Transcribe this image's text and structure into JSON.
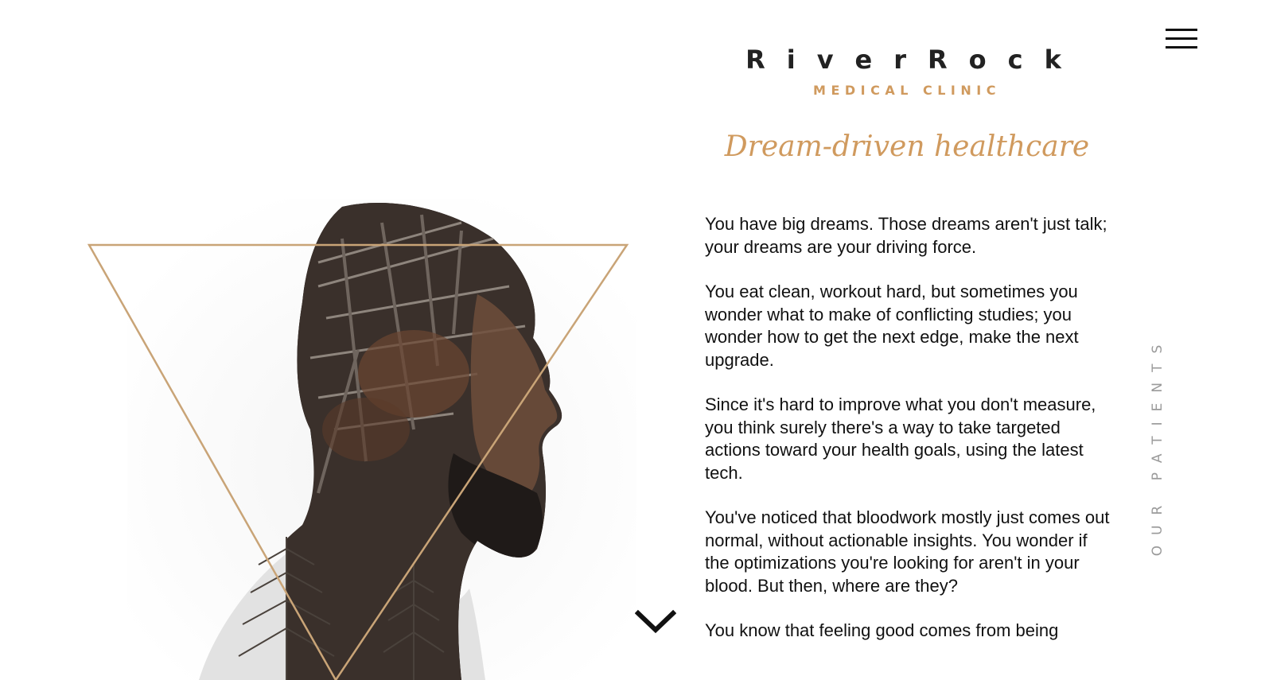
{
  "logo": {
    "name": "RiverRock",
    "subtitle": "MEDICAL CLINIC"
  },
  "header": {
    "tagline": "Dream-driven healthcare",
    "menu_icon": "hamburger-menu-icon"
  },
  "side_nav": {
    "label": "OUR PATIENTS"
  },
  "main": {
    "paragraphs": [
      "You have big dreams. Those dreams aren't just talk; your dreams are your driving force.",
      "You eat clean, workout hard, but sometimes you wonder what to make of conflicting studies; you wonder how to get the next edge, make the next upgrade.",
      "Since it's hard to improve what you don't measure, you think surely there's a way to take targeted actions toward your health goals, using the latest tech.",
      "You've noticed that bloodwork mostly just comes out normal, without actionable insights. You wonder if the optimizations you're looking for aren't in your blood. But then, where are they?",
      "You know that feeling good comes from being"
    ]
  },
  "hero": {
    "image": "double-exposure-portrait-bearded-man-with-trees",
    "triangle_color": "#c9a477"
  },
  "scroll": {
    "icon": "chevron-down-icon"
  },
  "colors": {
    "accent": "#d09a5e",
    "text": "#111111",
    "muted": "#9a9a9a",
    "background": "#ffffff"
  }
}
